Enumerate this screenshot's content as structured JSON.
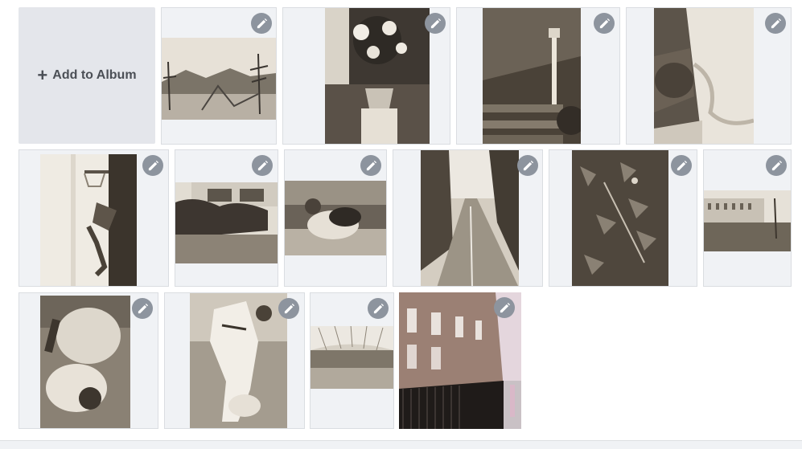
{
  "album": {
    "add_label": "Add to Album",
    "add_icon": "plus-icon",
    "edit_icon": "pencil-icon"
  },
  "photos": [
    {
      "subject": "landscape"
    },
    {
      "subject": "flowers"
    },
    {
      "subject": "garden-steps-lamp"
    },
    {
      "subject": "waterfall"
    },
    {
      "subject": "basketball"
    },
    {
      "subject": "house-lawn"
    },
    {
      "subject": "judo-ground"
    },
    {
      "subject": "road"
    },
    {
      "subject": "leaves"
    },
    {
      "subject": "mansion"
    },
    {
      "subject": "judo-pin"
    },
    {
      "subject": "judo-standing"
    },
    {
      "subject": "arcade-interior"
    },
    {
      "subject": "brick-street"
    }
  ]
}
